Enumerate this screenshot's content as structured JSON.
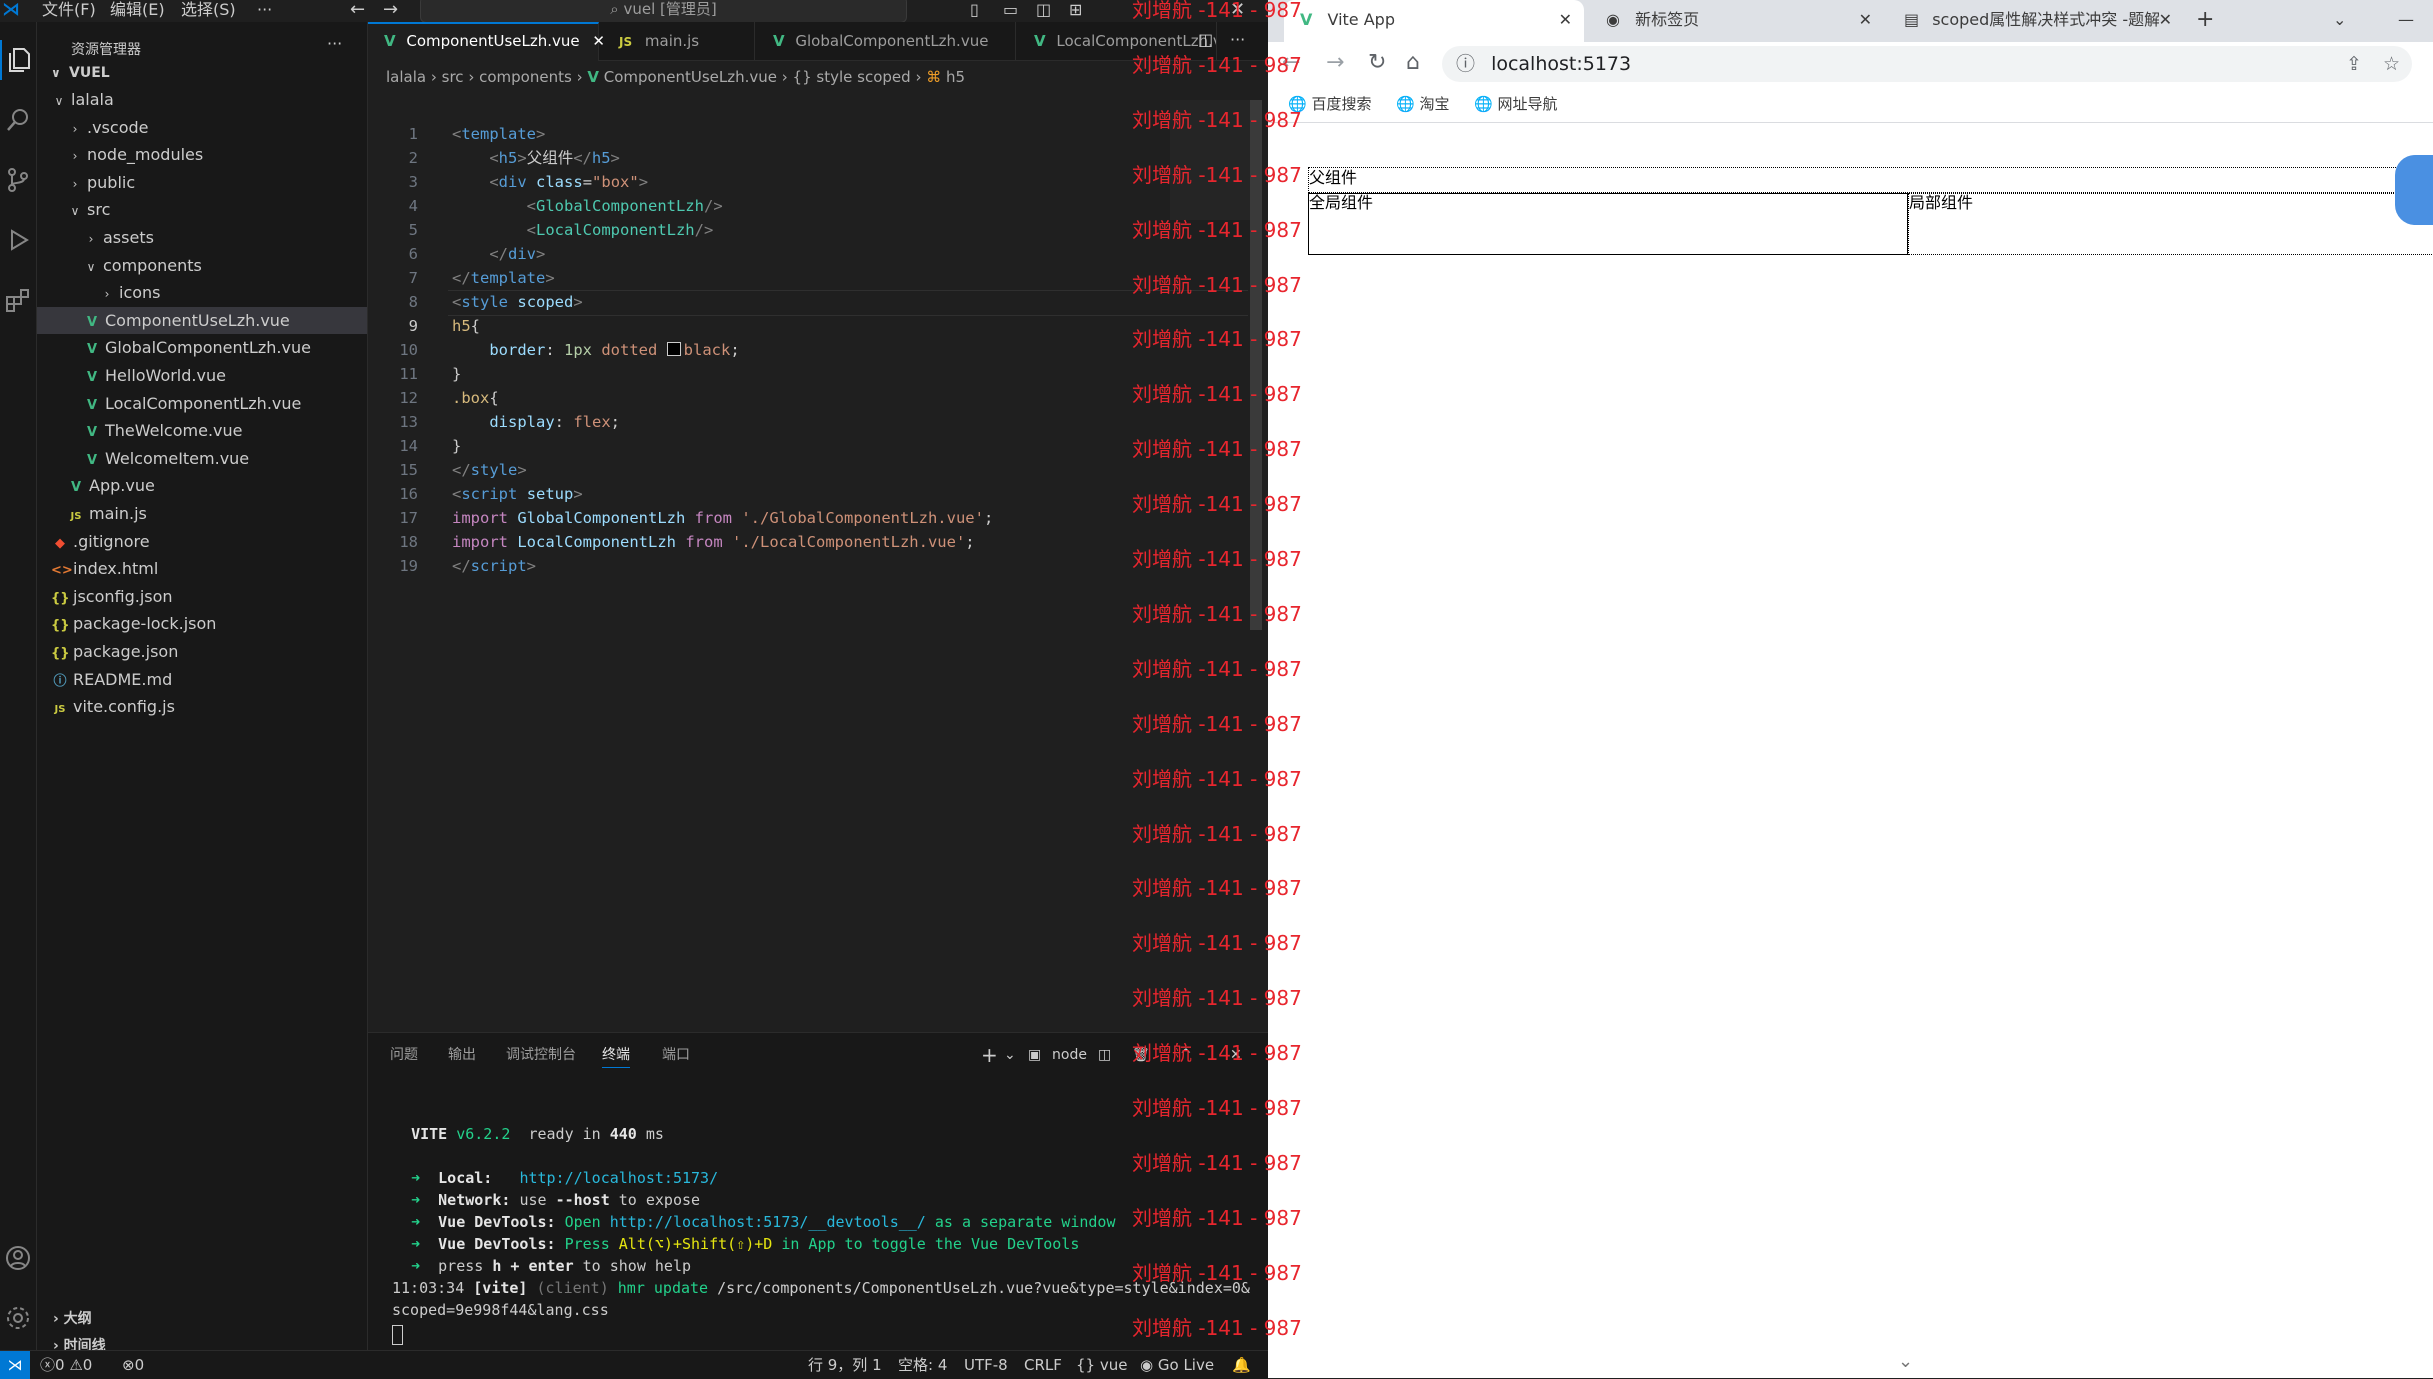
{
  "titlebar": {
    "menus": [
      "文件(F)",
      "编辑(E)",
      "选择(S)",
      "···"
    ],
    "search_text": "vuel [管理员]"
  },
  "sidebar": {
    "title": "资源管理器",
    "more": "···",
    "root": "VUEL",
    "items": [
      {
        "label": "lalala",
        "chev": "∨",
        "icon": ""
      },
      {
        "label": ".vscode",
        "chev": "›",
        "icon": ""
      },
      {
        "label": "node_modules",
        "chev": "›",
        "icon": ""
      },
      {
        "label": "public",
        "chev": "›",
        "icon": ""
      },
      {
        "label": "src",
        "chev": "∨",
        "icon": ""
      },
      {
        "label": "assets",
        "chev": "›",
        "icon": ""
      },
      {
        "label": "components",
        "chev": "∨",
        "icon": ""
      },
      {
        "label": "icons",
        "chev": "›",
        "icon": ""
      },
      {
        "label": "ComponentUseLzh.vue",
        "chev": "",
        "icon": "V"
      },
      {
        "label": "GlobalComponentLzh.vue",
        "chev": "",
        "icon": "V"
      },
      {
        "label": "HelloWorld.vue",
        "chev": "",
        "icon": "V"
      },
      {
        "label": "LocalComponentLzh.vue",
        "chev": "",
        "icon": "V"
      },
      {
        "label": "TheWelcome.vue",
        "chev": "",
        "icon": "V"
      },
      {
        "label": "WelcomeItem.vue",
        "chev": "",
        "icon": "V"
      },
      {
        "label": "App.vue",
        "chev": "",
        "icon": "V"
      },
      {
        "label": "main.js",
        "chev": "",
        "icon": "JS"
      },
      {
        "label": ".gitignore",
        "chev": "",
        "icon": "◆"
      },
      {
        "label": "index.html",
        "chev": "",
        "icon": "<>"
      },
      {
        "label": "jsconfig.json",
        "chev": "",
        "icon": "{}"
      },
      {
        "label": "package-lock.json",
        "chev": "",
        "icon": "{}"
      },
      {
        "label": "package.json",
        "chev": "",
        "icon": "{}"
      },
      {
        "label": "README.md",
        "chev": "",
        "icon": "ⓘ"
      },
      {
        "label": "vite.config.js",
        "chev": "",
        "icon": "JS"
      }
    ],
    "outline": "大纲",
    "timeline": "时间线"
  },
  "tabs": [
    {
      "label": "ComponentUseLzh.vue",
      "icon": "V",
      "close": "✕"
    },
    {
      "label": "main.js",
      "icon": "JS"
    },
    {
      "label": "GlobalComponentLzh.vue",
      "icon": "V"
    },
    {
      "label": "LocalComponentLzh.vue",
      "icon": "V"
    }
  ],
  "breadcrumb": [
    "lalala",
    "›",
    "src",
    "›",
    "components",
    "›",
    "ComponentUseLzh.vue",
    "›",
    "{} style scoped",
    "›",
    "h5"
  ],
  "code_lines": [
    "1",
    "2",
    "3",
    "4",
    "5",
    "6",
    "7",
    "8",
    "9",
    "10",
    "11",
    "12",
    "13",
    "14",
    "15",
    "16",
    "17",
    "18",
    "19"
  ],
  "code": {
    "l1": [
      "<",
      "template",
      ">"
    ],
    "l2": [
      "<",
      "h5",
      ">",
      "父组件",
      "</",
      "h5",
      ">"
    ],
    "l3": [
      "<",
      "div",
      "class",
      "=",
      "\"box\"",
      ">"
    ],
    "l4": [
      "<",
      "GlobalComponentLzh",
      "/>"
    ],
    "l5": [
      "<",
      "LocalComponentLzh",
      "/>"
    ],
    "l6": [
      "</",
      "div",
      ">"
    ],
    "l7": [
      "</",
      "template",
      ">"
    ],
    "l8": [
      "<",
      "style",
      "scoped",
      ">"
    ],
    "l9": [
      "h5",
      "{"
    ],
    "l10": [
      "border",
      ": ",
      "1px",
      " dotted ",
      "black",
      ";"
    ],
    "l11": [
      "}"
    ],
    "l12": [
      ".box",
      "{"
    ],
    "l13": [
      "display",
      ": ",
      "flex",
      ";"
    ],
    "l14": [
      "}"
    ],
    "l15": [
      "</",
      "style",
      ">"
    ],
    "l16": [
      "<",
      "script",
      "setup",
      ">"
    ],
    "l17": [
      "import",
      "GlobalComponentLzh",
      "from",
      "'./GlobalComponentLzh.vue'",
      ";"
    ],
    "l18": [
      "import",
      "LocalComponentLzh",
      "from",
      "'./LocalComponentLzh.vue'",
      ";"
    ],
    "l19": [
      "</",
      "script",
      ">"
    ]
  },
  "panel": {
    "tabs": [
      "问题",
      "输出",
      "调试控制台",
      "终端",
      "端口"
    ],
    "shell": "node",
    "add": "+",
    "terminal": {
      "vite_name": "VITE",
      "vite_ver": "v6.2.2",
      "ready": "ready in",
      "ms_val": "440",
      "ms": "ms",
      "arrow": "➜",
      "local_label": "Local:",
      "local_url": "http://localhost:5173/",
      "network_label": "Network:",
      "network_use": "use",
      "network_host": "--host",
      "network_rest": "to expose",
      "devtools_label": "Vue DevTools:",
      "devtools_open": "Open",
      "devtools_url": "http://localhost:5173/__devtools__/",
      "devtools_rest": "as a separate window",
      "devtools2_press": "Press",
      "devtools2_keys": "Alt(⌥)+Shift(⇧)+D",
      "devtools2_rest": "in App to toggle the Vue DevTools",
      "help_press": "press",
      "help_keys": "h + enter",
      "help_rest": "to show help",
      "time": "11:03:34",
      "vite_tag": "[vite]",
      "client": "(client)",
      "hmr": "hmr update",
      "path1": "/src/components/ComponentUseLzh.vue?vue&type=style&index=0&",
      "path2": "scoped=9e998f44&lang.css"
    }
  },
  "statusbar": {
    "errors": "0",
    "warnings": "0",
    "ports": "0",
    "position": "行 9，列 1",
    "spaces": "空格: 4",
    "encoding": "UTF-8",
    "eol": "CRLF",
    "lang": "vue",
    "golive": "Go Live"
  },
  "watermark": "刘增航 -141 - 987",
  "browser": {
    "tabs": [
      {
        "title": "Vite App"
      },
      {
        "title": "新标签页"
      },
      {
        "title": "scoped属性解决样式冲突 -题解"
      }
    ],
    "new_tab": "+",
    "url": "localhost:5173",
    "bookmarks": [
      "百度搜索",
      "淘宝",
      "网址导航"
    ],
    "page": {
      "h5": "父组件",
      "global": "全局组件",
      "local": "局部组件"
    }
  },
  "colors": {
    "accent": "#0078d4",
    "watermark": "#e8262e",
    "vue_green": "#41b883"
  }
}
